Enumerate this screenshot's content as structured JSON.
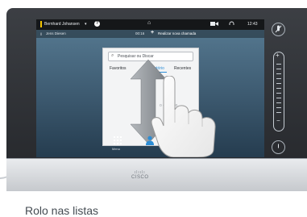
{
  "status_bar": {
    "user_name": "Bernhard Johansen",
    "time": "12:43"
  },
  "call_bar": {
    "participant": "Jens Diesen",
    "duration": "00:16",
    "new_call_label": "Realizar nova chamada"
  },
  "directory": {
    "search_placeholder": "Pesquisar ou Discar",
    "tabs": [
      "Favoritos",
      "Diretório",
      "Recentes"
    ],
    "active_tab": "Diretório",
    "hint_partial": "o diretório"
  },
  "bottom_bar": {
    "menu_label": "Menu"
  },
  "logo_text": "CISCO",
  "caption": "Rolo nas listas",
  "colors": {
    "accent_blue": "#2b8dd6",
    "user_marker_yellow": "#f4c400",
    "arrow_gray": "#8f9498"
  },
  "icons": {
    "dropdown": "chevron-down-icon",
    "help": "question-icon",
    "home": "home-icon",
    "camera": "camera-icon",
    "headset": "headset-icon",
    "add_call": "plus-icon",
    "call_indicator": "pause-icon",
    "search": "search-icon",
    "menu": "grid-icon",
    "contact": "contact-icon",
    "mute": "mute-icon",
    "volume_up": "plus-icon",
    "volume_down": "minus-icon",
    "power": "power-icon"
  }
}
